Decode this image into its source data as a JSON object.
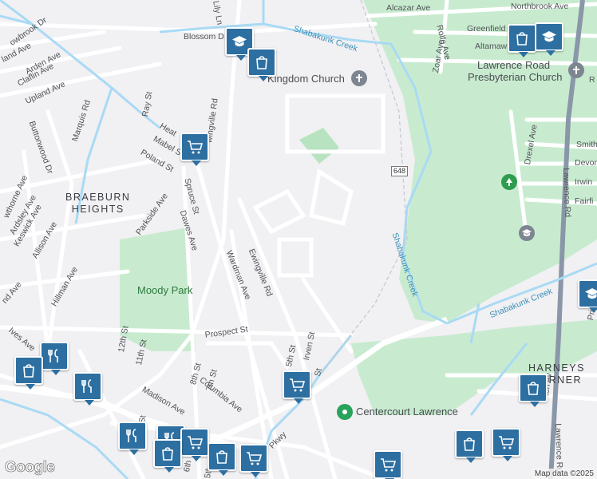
{
  "map": {
    "attribution": "Map data ©2025",
    "logo": "Google",
    "colors": {
      "park": "#c8ebcf",
      "water": "#a9daf4",
      "road": "#ffffff",
      "road_border": "#d6d6d9",
      "highway": "#8a97a8",
      "pin": "#2d6fa1"
    },
    "streets": {
      "alcazar": "Alcazar Ave",
      "northbrook": "Northbrook Ave",
      "rolfe": "Rolfe Ave",
      "greenfield": "Greenfield Ave",
      "altamawr": "Altamawr",
      "zoar": "Zoar Ave",
      "lily": "Lily Ln",
      "blossom": "Blossom D",
      "lowbrook": "owbrook Dr",
      "arden": "Arden Ave",
      "claflin": "Claflin Ave",
      "upland2": "land Ave",
      "upland": "Upland Ave",
      "marquis": "Marquis Rd",
      "ray": "Ray St",
      "buttonwood": "Buttonwood Dr",
      "heath": "Heat",
      "mabel": "Mabel S",
      "ewingville_n": "wingville Rd",
      "poland": "Poland St",
      "parkside": "Parkside Ave",
      "spruce": "Spruce St",
      "dawes": "Dawes Ave",
      "wardman": "Wardman Ave",
      "ewingville_s": "Ewingville Rd",
      "hawthorne": "wthorne Ave",
      "ardsley": "Ardsley Ave",
      "keswick": "Keswick Ave",
      "allison": "Allison Ave",
      "hillman": "Hillman Ave",
      "nd": "nd Ave",
      "ives": "Ives Ave",
      "twelfth": "12th St",
      "eleventh": "11th St",
      "eighth": "8th St",
      "seventh": "7th St",
      "prospect": "Prospect St",
      "fifth": "5th St",
      "irven": "Irven St",
      "st": "St",
      "columbia": "Columbia Ave",
      "madison": "Madison Ave",
      "st2": "ct St",
      "pkwy": "Pkwy",
      "sixth": "6th",
      "fifth2": "5th",
      "drexel": "Drexel Ave",
      "smith": "Smith",
      "devon": "Devon",
      "irwin": "Irwin",
      "fairfi": "Fairfi",
      "lawrence_rd": "Lawrence Rd",
      "lawrence_rd_s": "Lawrence Rd",
      "princeton": "Princeton",
      "ton_av": "ton Av",
      "r": "R"
    },
    "route_shield": "648",
    "district": {
      "line1": "BRAEBURN",
      "line2": "HEIGHTS"
    },
    "district2": {
      "line1": "HARNEYS",
      "line2": "CORNER"
    },
    "creeks": {
      "top": "Shabakunk Creek",
      "mid": "Shabakunk Creek",
      "east": "Shabakunk Creek"
    },
    "parks": {
      "moody": "Moody Park"
    },
    "places": {
      "kingdom": "Kingdom Church",
      "lawrence_pres_1": "Lawrence Road",
      "lawrence_pres_2": "Presbyterian Church",
      "centercourt": "Centercourt Lawrence"
    },
    "pins": [
      {
        "icon": "school-icon"
      },
      {
        "icon": "shopping-bag-icon"
      },
      {
        "icon": "cart-icon"
      },
      {
        "icon": "shopping-bag-icon"
      },
      {
        "icon": "school-icon"
      },
      {
        "icon": "school-icon"
      },
      {
        "icon": "cart-icon"
      },
      {
        "icon": "shopping-bag-icon"
      },
      {
        "icon": "cart-icon"
      },
      {
        "icon": "shopping-bag-icon"
      },
      {
        "icon": "restaurant-icon"
      },
      {
        "icon": "shopping-bag-icon"
      },
      {
        "icon": "restaurant-icon"
      },
      {
        "icon": "restaurant-icon"
      },
      {
        "icon": "restaurant-icon"
      },
      {
        "icon": "cart-icon"
      },
      {
        "icon": "shopping-bag-icon"
      },
      {
        "icon": "shopping-bag-icon"
      },
      {
        "icon": "cart-icon"
      },
      {
        "icon": "cart-icon"
      }
    ]
  }
}
